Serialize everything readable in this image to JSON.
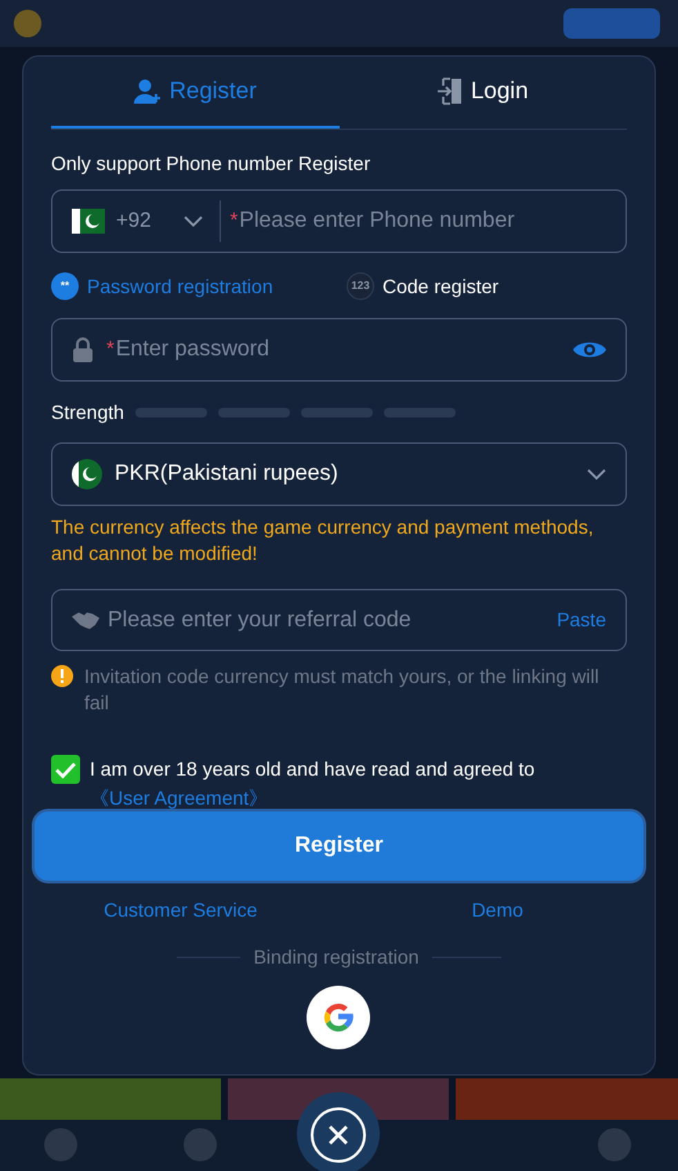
{
  "tabs": [
    {
      "label": "Register",
      "kind": "register",
      "selected": true
    },
    {
      "label": "Login",
      "kind": "login",
      "selected": false
    }
  ],
  "notice": "Only support Phone number Register",
  "phone": {
    "country_code": "+92",
    "required_mark": "*",
    "placeholder": "Please enter Phone number"
  },
  "methods": [
    {
      "label": "Password registration",
      "icon_text": "**",
      "selected": true
    },
    {
      "label": "Code register",
      "icon_text": "123",
      "selected": false
    }
  ],
  "password": {
    "required_mark": "*",
    "placeholder": "Enter password"
  },
  "strength": {
    "label": "Strength"
  },
  "currency": {
    "value": "PKR(Pakistani rupees)"
  },
  "currency_warning": "The currency affects the game currency and payment methods, and cannot be modified!",
  "referral": {
    "placeholder": "Please enter your referral code",
    "action": "Paste"
  },
  "referral_note": "Invitation code currency must match yours, or the linking will fail",
  "agreement": {
    "checked": true,
    "text": "I am over 18 years old and have read and agreed to",
    "link": "《User Agreement》"
  },
  "submit": "Register",
  "links": [
    "Customer Service",
    "Demo"
  ],
  "binding_label": "Binding registration"
}
